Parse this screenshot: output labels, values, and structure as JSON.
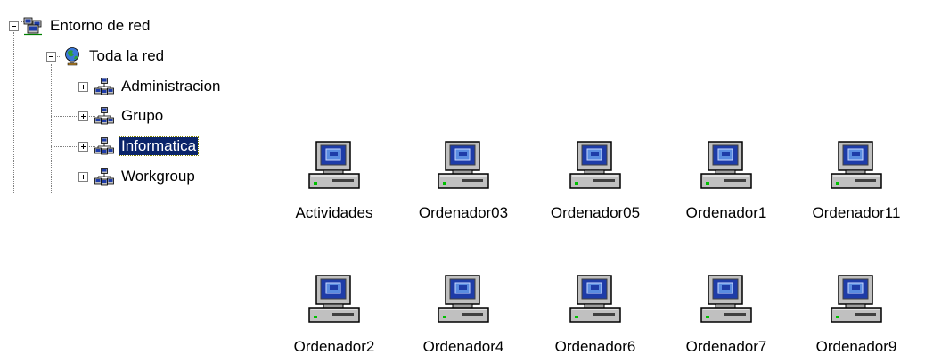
{
  "tree": {
    "root": {
      "label": "Entorno de red",
      "icon": "network-neighborhood-icon",
      "expanded": true
    },
    "entire_network": {
      "label": "Toda la red",
      "icon": "globe-network-icon",
      "expanded": true
    },
    "workgroups": [
      {
        "label": "Administracion",
        "icon": "workgroup-icon",
        "expanded": false,
        "selected": false
      },
      {
        "label": "Grupo",
        "icon": "workgroup-icon",
        "expanded": false,
        "selected": false
      },
      {
        "label": "Informatica",
        "icon": "workgroup-icon",
        "expanded": false,
        "selected": true
      },
      {
        "label": "Workgroup",
        "icon": "workgroup-icon",
        "expanded": false,
        "selected": false
      }
    ]
  },
  "items": [
    {
      "label": "Actividades",
      "icon": "computer-icon"
    },
    {
      "label": "Ordenador03",
      "icon": "computer-icon"
    },
    {
      "label": "Ordenador05",
      "icon": "computer-icon"
    },
    {
      "label": "Ordenador1",
      "icon": "computer-icon"
    },
    {
      "label": "Ordenador11",
      "icon": "computer-icon"
    },
    {
      "label": "Ordenador2",
      "icon": "computer-icon"
    },
    {
      "label": "Ordenador4",
      "icon": "computer-icon"
    },
    {
      "label": "Ordenador6",
      "icon": "computer-icon"
    },
    {
      "label": "Ordenador7",
      "icon": "computer-icon"
    },
    {
      "label": "Ordenador9",
      "icon": "computer-icon"
    }
  ],
  "colors": {
    "selection": "#0a246a",
    "screen": "#1e3ca8",
    "case": "#c0c0c0",
    "power_led": "#00c000"
  }
}
